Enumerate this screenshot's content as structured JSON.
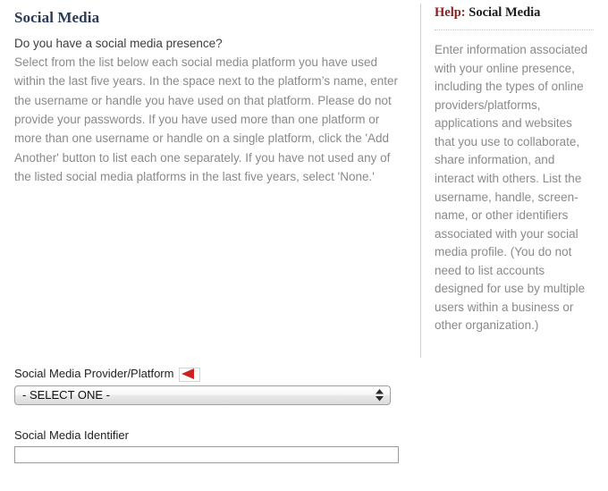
{
  "main": {
    "section_title": "Social Media",
    "question": "Do you have a social media presence?",
    "instructions": "Select from the list below each social media platform you have used within the last five years. In the space next to the platform’s name, enter the username or handle you have used on that platform. Please do not provide your passwords. If you have used more than one platform or more than one username or handle on a single platform, click the 'Add Another' button to list each one separately. If you have not used any of the listed social media platforms in the last five years, select 'None.'"
  },
  "form": {
    "provider_label": "Social Media Provider/Platform",
    "provider_required_icon": "red-left-arrow-icon",
    "provider_selected": "- SELECT ONE -",
    "provider_options": [
      "- SELECT ONE -"
    ],
    "identifier_label": "Social Media Identifier",
    "identifier_value": "",
    "identifier_placeholder": ""
  },
  "help": {
    "title_prefix": "Help:",
    "title_topic": "Social Media",
    "body": "Enter information associated with your online presence, including the types of online providers/platforms, applications and websites that you use to collaborate, share information, and interact with others. List the username, handle, screen-name, or other identifiers associated with your social media profile. (You do not need to list accounts designed for use by multiple users within a business or other organization.)"
  },
  "colors": {
    "section_title": "#2b3a55",
    "help_accent": "#8c1d1d",
    "body_text": "#8a8a8a",
    "label_text": "#222222",
    "required_arrow": "#cc2222",
    "divider": "#cfcfcf"
  }
}
